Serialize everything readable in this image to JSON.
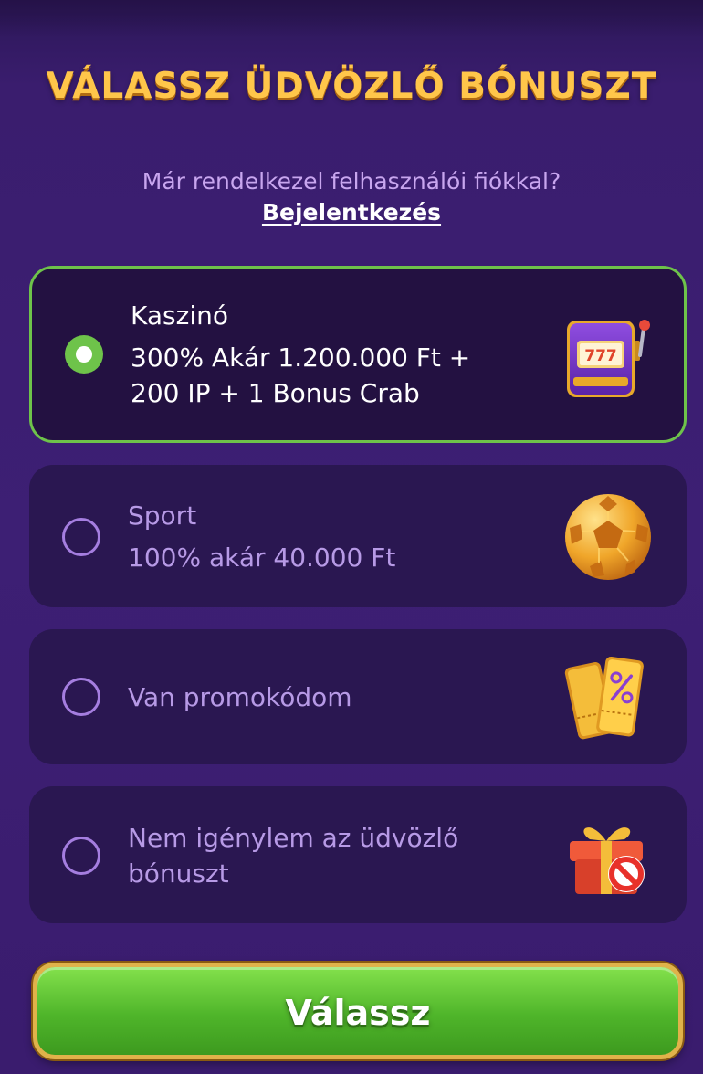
{
  "header": {
    "title": "VÁLASSZ ÜDVÖZLŐ BÓNUSZT",
    "subtitle": "Már rendelkezel felhasználói fiókkal?",
    "login_link": "Bejelentkezés"
  },
  "options": [
    {
      "title": "Kaszinó",
      "description_lines": [
        "300% Akár 1.200.000 Ft +",
        "200 IP + 1 Bonus Crab"
      ],
      "icon": "slot-machine-icon",
      "selected": true
    },
    {
      "title": "Sport",
      "description_lines": [
        "100% akár 40.000 Ft"
      ],
      "icon": "soccer-ball-icon",
      "selected": false
    },
    {
      "title": "Van promokódom",
      "description_lines": [],
      "icon": "promo-ticket-icon",
      "selected": false
    },
    {
      "title_lines": [
        "Nem igénylem az üdvözlő",
        "bónuszt"
      ],
      "icon": "gift-no-icon",
      "selected": false
    }
  ],
  "submit": {
    "label": "Válassz"
  },
  "colors": {
    "background": "#3a1d6e",
    "title_gold": "#ffc64a",
    "selected_border": "#6ec34a",
    "radio_outline": "#a57ee0",
    "button_green": "#4fb52a"
  }
}
